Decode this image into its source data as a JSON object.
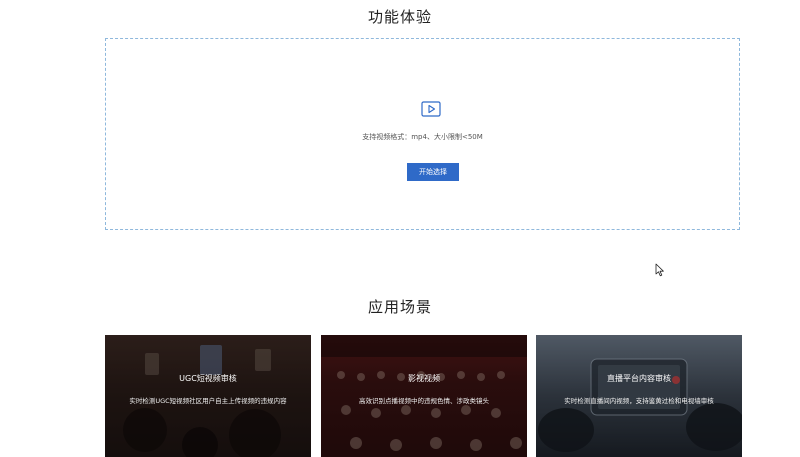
{
  "experience": {
    "title": "功能体验",
    "upload_hint": "支持视频格式：mp4、大小限制<50M",
    "start_button": "开始选择"
  },
  "scenarios": {
    "title": "应用场景",
    "cards": [
      {
        "title": "UGC短视频审核",
        "desc": "实时检测UGC短视频社区用户自主上传视频的违规内容"
      },
      {
        "title": "影视视频",
        "desc": "高效识别点播视频中的违规色情、涉政类镜头"
      },
      {
        "title": "直播平台内容审核",
        "desc": "实时检测直播间内视频，支持鉴黄过检和电视墙审核"
      }
    ]
  },
  "colors": {
    "accent": "#2f6ac8",
    "dashed_border": "#8fb8dc"
  }
}
